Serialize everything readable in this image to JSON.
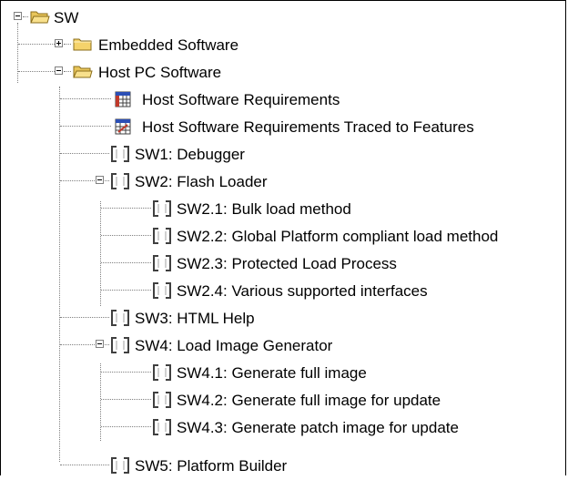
{
  "tree": {
    "root": {
      "label": "SW",
      "icon": "folder-open-icon",
      "expanded": true
    },
    "embedded": {
      "label": "Embedded Software",
      "icon": "folder-closed-icon",
      "expanded": false
    },
    "host": {
      "label": "Host PC Software",
      "icon": "folder-open-icon",
      "expanded": true
    },
    "host_children": [
      {
        "label": "Host Software Requirements",
        "icon": "table-icon"
      },
      {
        "label": "Host Software Requirements Traced to Features",
        "icon": "trace-table-icon"
      },
      {
        "label": "SW1: Debugger",
        "icon": "requirement-icon"
      },
      {
        "label": "SW2: Flash Loader",
        "icon": "requirement-icon",
        "expanded": true
      },
      {
        "label": "SW2.1: Bulk load method",
        "icon": "requirement-icon"
      },
      {
        "label": "SW2.2: Global Platform compliant load method",
        "icon": "requirement-icon"
      },
      {
        "label": "SW2.3: Protected Load Process",
        "icon": "requirement-icon"
      },
      {
        "label": "SW2.4: Various supported interfaces",
        "icon": "requirement-icon"
      },
      {
        "label": "SW3: HTML Help",
        "icon": "requirement-icon"
      },
      {
        "label": "SW4: Load Image Generator",
        "icon": "requirement-icon",
        "expanded": true
      },
      {
        "label": "SW4.1: Generate full image",
        "icon": "requirement-icon"
      },
      {
        "label": "SW4.2: Generate full image for update",
        "icon": "requirement-icon"
      },
      {
        "label": "SW4.3: Generate patch image for update",
        "icon": "requirement-icon"
      },
      {
        "label": "SW5: Platform Builder",
        "icon": "requirement-icon"
      }
    ]
  },
  "colors": {
    "folder": "#f5d36b",
    "folder_dark": "#b8860b",
    "line": "#808080",
    "text": "#000000"
  }
}
